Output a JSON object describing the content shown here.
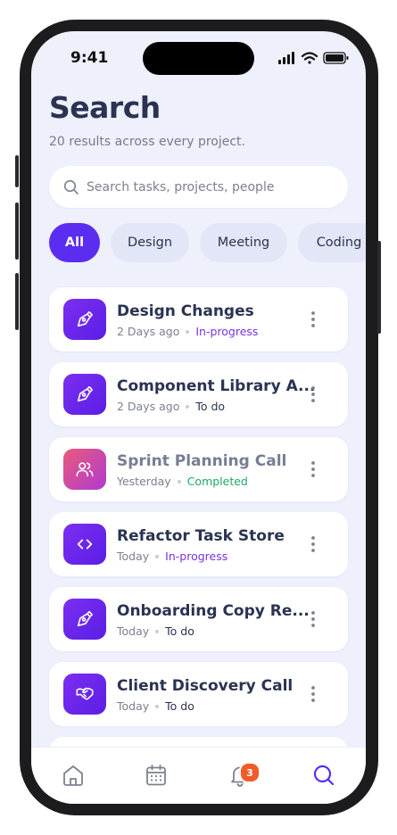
{
  "status_bar": {
    "time": "9:41"
  },
  "header": {
    "title": "Search",
    "subtitle": "20 results across every project."
  },
  "search": {
    "placeholder": "Search tasks, projects, people",
    "value": ""
  },
  "filters": [
    {
      "label": "All",
      "active": true
    },
    {
      "label": "Design",
      "active": false
    },
    {
      "label": "Meeting",
      "active": false
    },
    {
      "label": "Coding",
      "active": false
    }
  ],
  "results": [
    {
      "title": "Design Changes",
      "time": "2 Days ago",
      "status": "In-progress",
      "icon": "pen-tool-icon"
    },
    {
      "title": "Component Library A...",
      "time": "2 Days ago",
      "status": "To do",
      "icon": "pen-tool-icon"
    },
    {
      "title": "Sprint Planning Call",
      "time": "Yesterday",
      "status": "Completed",
      "icon": "users-icon"
    },
    {
      "title": "Refactor Task Store",
      "time": "Today",
      "status": "In-progress",
      "icon": "code-icon"
    },
    {
      "title": "Onboarding Copy Re...",
      "time": "Today",
      "status": "To do",
      "icon": "pen-tool-icon"
    },
    {
      "title": "Client Discovery Call",
      "time": "Today",
      "status": "To do",
      "icon": "handshake-icon"
    }
  ],
  "tab_bar": {
    "items": [
      "home-icon",
      "calendar-icon",
      "bell-icon",
      "search-icon"
    ],
    "active": "search-icon",
    "notification_count": "3"
  },
  "colors": {
    "accent": "#5b2df0",
    "background": "#eef0fc",
    "in_progress": "#7a32e0",
    "completed": "#1fa86a",
    "badge": "#f15a29"
  }
}
